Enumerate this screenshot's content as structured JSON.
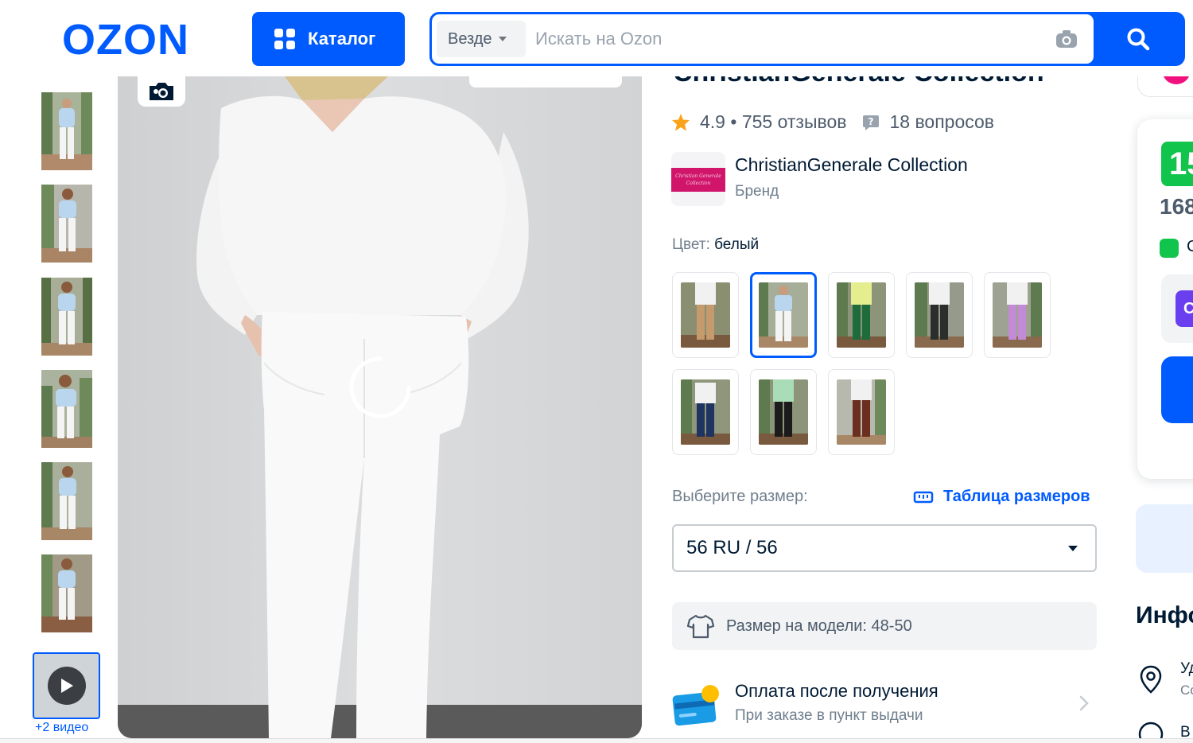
{
  "header": {
    "logo": "OZON",
    "catalog_label": "Каталог",
    "search_scope": "Везде",
    "search_placeholder": "Искать на Ozon"
  },
  "gallery": {
    "video_count": "+2 видео"
  },
  "product": {
    "title_partial": "ChristianGenerale Collection",
    "rating": "4.9",
    "reviews": "755 отзывов",
    "questions": "18 вопросов",
    "brand_name": "ChristianGenerale Collection",
    "brand_label": "Бренд",
    "brand_logo_text": "Christian Generale Collection",
    "color_label": "Цвет:",
    "color_value": "белый",
    "color_swatches": [
      "бежевый",
      "белый",
      "зелёный",
      "чёрный",
      "сиреневый",
      "синий",
      "чёрный",
      "коричневый"
    ],
    "size_label": "Выберите размер:",
    "size_table_label": "Таблица размеров",
    "size_selected": "56 RU / 56",
    "model_size": "Размер на модели: 48-50",
    "payment_title": "Оплата после получения",
    "payment_sub": "При заказе в пункт выдачи"
  },
  "right_column": {
    "price_partial": "15",
    "old_price_partial": "168",
    "green_text_partial": "С",
    "purple_btn_partial": "C",
    "info_partial": "Инфо",
    "loc_line1": "Уд",
    "loc_line2": "Со",
    "last_line": "В"
  },
  "colors": {
    "brand_blue": "#005bff",
    "price_green": "#10c44c",
    "star": "#f9a31a",
    "text_dark": "#001a34",
    "text_grey": "#707f8d"
  }
}
